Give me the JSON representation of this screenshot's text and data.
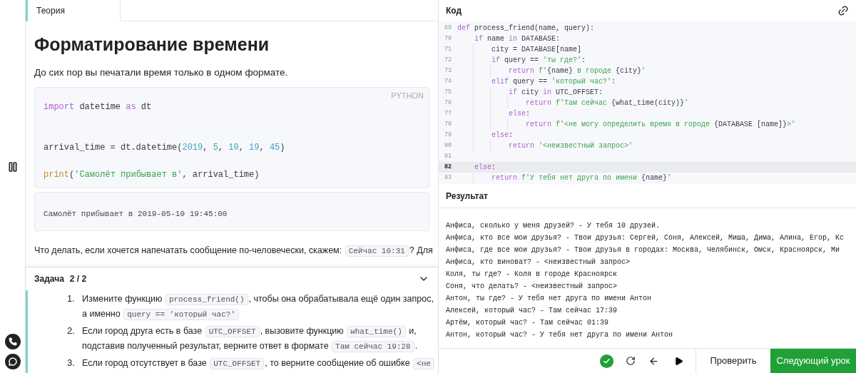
{
  "theory": {
    "tab": {
      "label": "Теория",
      "selected": true
    },
    "title": "Форматирование времени",
    "intro": "До сих пор вы печатали время только в одном формате.",
    "code_block": {
      "language": "PYTHON",
      "lines": [
        {
          "kind": "code",
          "tokens": [
            {
              "kind": "kw",
              "text": "import"
            },
            {
              "kind": "plain",
              "text": " datetime "
            },
            {
              "kind": "kw",
              "text": "as"
            },
            {
              "kind": "plain",
              "text": " dt"
            }
          ]
        },
        {
          "kind": "blank"
        },
        {
          "kind": "blank"
        },
        {
          "kind": "code",
          "tokens": [
            {
              "kind": "plain",
              "text": "arrival_time = dt.datetime("
            },
            {
              "kind": "num",
              "text": "2019"
            },
            {
              "kind": "plain",
              "text": ", "
            },
            {
              "kind": "num",
              "text": "5"
            },
            {
              "kind": "plain",
              "text": ", "
            },
            {
              "kind": "num",
              "text": "10"
            },
            {
              "kind": "plain",
              "text": ", "
            },
            {
              "kind": "num",
              "text": "19"
            },
            {
              "kind": "plain",
              "text": ", "
            },
            {
              "kind": "num",
              "text": "45"
            },
            {
              "kind": "plain",
              "text": ")"
            }
          ]
        },
        {
          "kind": "blank"
        },
        {
          "kind": "code",
          "tokens": [
            {
              "kind": "builtin",
              "text": "print"
            },
            {
              "kind": "plain",
              "text": "("
            },
            {
              "kind": "str",
              "text": "'Самолёт прибывает в'"
            },
            {
              "kind": "plain",
              "text": ", arrival_time)"
            }
          ]
        }
      ]
    },
    "output_block": {
      "lines": [
        "Самолёт прибывает в 2019-05-10 19:45:00"
      ]
    },
    "paragraph": [
      {
        "kind": "text",
        "text": "Что делать, если хочется напечатать сообщение по-человечески, скажем: "
      },
      {
        "kind": "code",
        "text": "Сейчас 10:31"
      },
      {
        "kind": "text",
        "text": "? Для"
      }
    ]
  },
  "task": {
    "title": "Задача",
    "counter": "2 / 2",
    "items": [
      {
        "number": "1.",
        "segments": [
          {
            "kind": "text",
            "text": "Измените функцию "
          },
          {
            "kind": "code",
            "text": "process_friend()"
          },
          {
            "kind": "text",
            "text": ", чтобы она обрабатывала ещё один запрос, а именно "
          },
          {
            "kind": "code",
            "text": "query == 'который час?'"
          }
        ]
      },
      {
        "number": "2.",
        "segments": [
          {
            "kind": "text",
            "text": "Если город друга есть в базе "
          },
          {
            "kind": "code",
            "text": "UTC_OFFSET"
          },
          {
            "kind": "text",
            "text": ", вызовите функцию "
          },
          {
            "kind": "code",
            "text": "what_time()"
          },
          {
            "kind": "text",
            "text": " и, подставив полученный результат, верните ответ в формате "
          },
          {
            "kind": "code",
            "text": "Там сейчас 19:28"
          },
          {
            "kind": "text",
            "text": "."
          }
        ]
      },
      {
        "number": "3.",
        "segments": [
          {
            "kind": "text",
            "text": "Если город отсутствует в базе "
          },
          {
            "kind": "code",
            "text": "UTC_OFFSET"
          },
          {
            "kind": "text",
            "text": ", то верните сообщение об ошибке "
          },
          {
            "kind": "code",
            "text": "<не"
          }
        ]
      }
    ]
  },
  "editor": {
    "title": "Код",
    "lines": [
      {
        "number": "69",
        "current": false,
        "kind": "code",
        "tokens": [
          {
            "kind": "kw",
            "text": "def"
          },
          {
            "kind": "plain",
            "text": " process_friend(name, query):"
          }
        ]
      },
      {
        "number": "70",
        "current": false,
        "kind": "code",
        "tokens": [
          {
            "kind": "kw",
            "text": "    if"
          },
          {
            "kind": "plain",
            "text": " name "
          },
          {
            "kind": "kw",
            "text": "in"
          },
          {
            "kind": "plain",
            "text": " DATABASE:"
          }
        ]
      },
      {
        "number": "71",
        "current": false,
        "kind": "code",
        "tokens": [
          {
            "kind": "plain",
            "text": "        city = DATABASE[name]"
          }
        ]
      },
      {
        "number": "72",
        "current": false,
        "kind": "code",
        "tokens": [
          {
            "kind": "kw",
            "text": "        if"
          },
          {
            "kind": "plain",
            "text": " query == "
          },
          {
            "kind": "str",
            "text": "'ты где?'"
          },
          {
            "kind": "plain",
            "text": ":"
          }
        ]
      },
      {
        "number": "73",
        "current": false,
        "kind": "code",
        "tokens": [
          {
            "kind": "kw",
            "text": "            return"
          },
          {
            "kind": "str",
            "text": " f'"
          },
          {
            "kind": "plain",
            "text": "{name}"
          },
          {
            "kind": "str",
            "text": " в городе "
          },
          {
            "kind": "plain",
            "text": "{city}"
          },
          {
            "kind": "str",
            "text": "'"
          }
        ]
      },
      {
        "number": "74",
        "current": false,
        "kind": "code",
        "tokens": [
          {
            "kind": "kw",
            "text": "        elif"
          },
          {
            "kind": "plain",
            "text": " query == "
          },
          {
            "kind": "str",
            "text": "'который час?'"
          },
          {
            "kind": "plain",
            "text": ":"
          }
        ]
      },
      {
        "number": "75",
        "current": false,
        "kind": "code",
        "tokens": [
          {
            "kind": "kw",
            "text": "            if"
          },
          {
            "kind": "plain",
            "text": " city "
          },
          {
            "kind": "kw",
            "text": "in"
          },
          {
            "kind": "plain",
            "text": " UTC_OFFSET:"
          }
        ]
      },
      {
        "number": "76",
        "current": false,
        "kind": "code",
        "tokens": [
          {
            "kind": "kw",
            "text": "                return"
          },
          {
            "kind": "str",
            "text": " f'Там сейчас "
          },
          {
            "kind": "plain",
            "text": "{what_time(city)}"
          },
          {
            "kind": "str",
            "text": "'"
          }
        ]
      },
      {
        "number": "77",
        "current": false,
        "kind": "code",
        "tokens": [
          {
            "kind": "kw",
            "text": "            else"
          },
          {
            "kind": "plain",
            "text": ":"
          }
        ]
      },
      {
        "number": "78",
        "current": false,
        "kind": "code",
        "tokens": [
          {
            "kind": "kw",
            "text": "                return"
          },
          {
            "kind": "str",
            "text": " f'<не могу определить время в городе "
          },
          {
            "kind": "plain",
            "text": "{DATABASE [name]}"
          },
          {
            "kind": "str",
            "text": ">'"
          }
        ]
      },
      {
        "number": "79",
        "current": false,
        "kind": "code",
        "tokens": [
          {
            "kind": "kw",
            "text": "        else"
          },
          {
            "kind": "plain",
            "text": ":"
          }
        ]
      },
      {
        "number": "80",
        "current": false,
        "kind": "code",
        "tokens": [
          {
            "kind": "kw",
            "text": "            return"
          },
          {
            "kind": "str",
            "text": " '<неизвестный запрос>'"
          }
        ]
      },
      {
        "number": "81",
        "current": false,
        "kind": "blank"
      },
      {
        "number": "82",
        "current": true,
        "kind": "code",
        "tokens": [
          {
            "kind": "kw",
            "text": "    else"
          },
          {
            "kind": "plain",
            "text": ":"
          }
        ]
      },
      {
        "number": "83",
        "current": false,
        "kind": "code",
        "tokens": [
          {
            "kind": "kw",
            "text": "        return"
          },
          {
            "kind": "str",
            "text": " f'У тебя нет друга по имени "
          },
          {
            "kind": "plain",
            "text": "{name}"
          },
          {
            "kind": "str",
            "text": "'"
          }
        ]
      }
    ]
  },
  "result": {
    "title": "Результат",
    "lines": [
      "Анфиса, сколько у меня друзей? - У тебя 10 друзей.",
      "Анфиса, кто все мои друзья? - Твои друзья: Сергей, Соня, Алексей, Миша, Дима, Алина, Егор, Кс",
      "Анфиса, где все мои друзья? - Твои друзья в городах: Москва, Челябинск, Омск, Красноярск, Ми",
      "Анфиса, кто виноват? - <неизвестный запрос>",
      "Коля, ты где? - Коля в городе Красноярск",
      "Соня, что делать? - <неизвестный запрос>",
      "Антон, ты где? - У тебя нет друга по имени Антон",
      "Алексей, который час? - Там сейчас 17:39",
      "Артём, который час? - Там сейчас 01:39",
      "Антон, который час? - У тебя нет друга по имени Антон"
    ]
  },
  "toolbar": {
    "solved": true,
    "check_button": "Проверить",
    "next_button": "Следующий урок"
  }
}
